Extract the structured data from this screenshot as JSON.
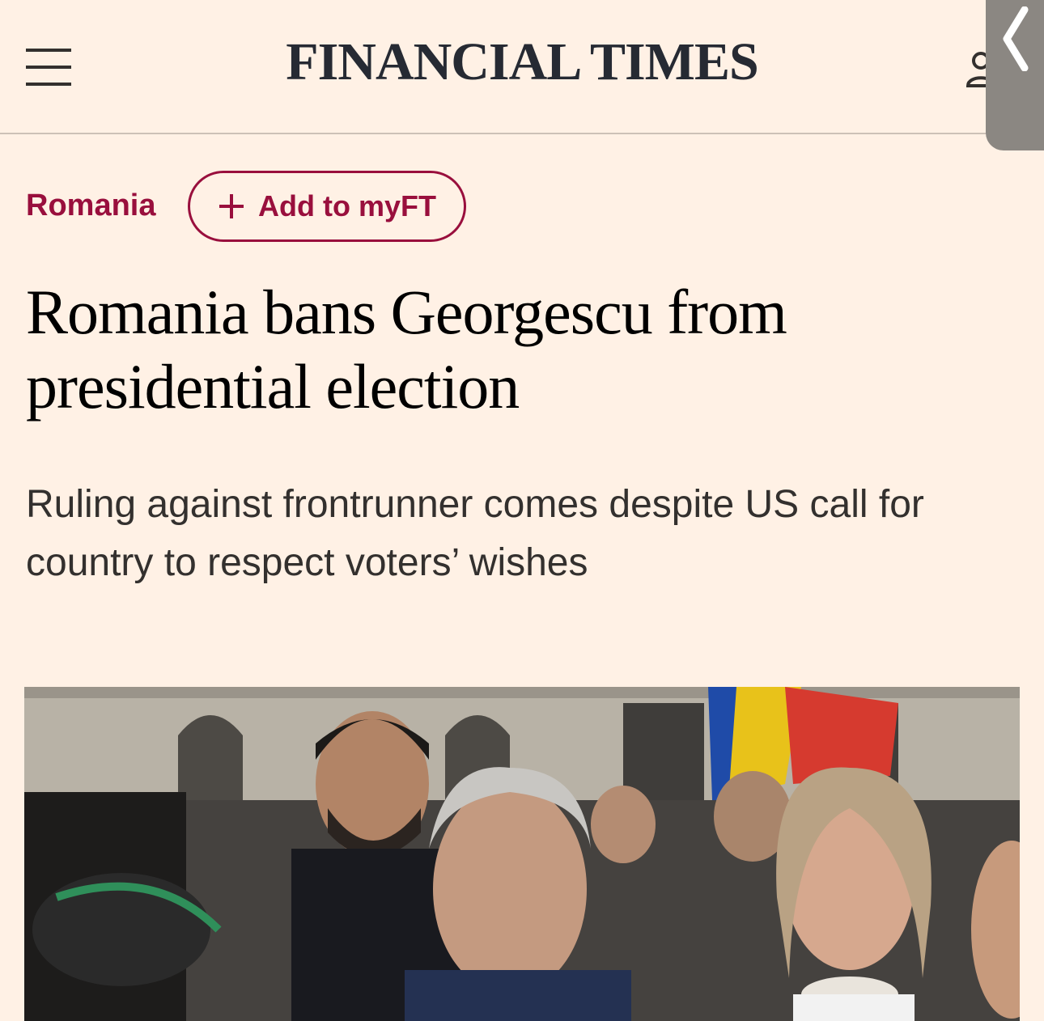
{
  "header": {
    "brand": "FINANCIAL TIMES",
    "menu_icon": "hamburger-menu-icon",
    "user_icon": "user-account-icon",
    "side_tab_icon": "chevron-left-icon"
  },
  "article": {
    "topic": "Romania",
    "myft_label": "Add to myFT",
    "headline": "Romania bans Georgescu from presidential election",
    "standfirst": "Ruling against frontrunner comes despite US call for country to respect voters’ wishes"
  },
  "colors": {
    "background": "#fff1e5",
    "accent": "#990f3d",
    "text": "#33302e"
  }
}
